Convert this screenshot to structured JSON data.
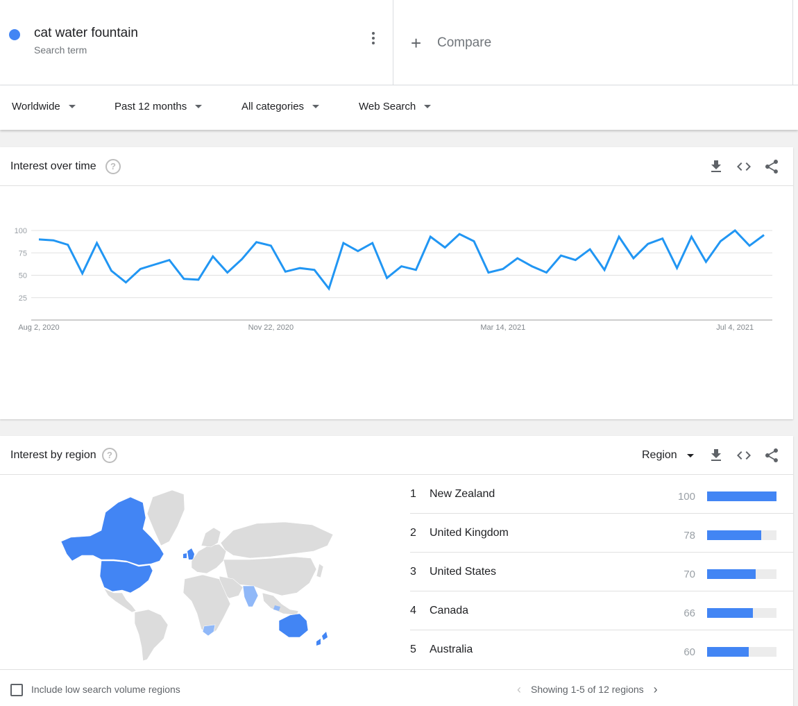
{
  "search_term": {
    "title": "cat water fountain",
    "subtitle": "Search term",
    "color": "#4285f4"
  },
  "compare": {
    "label": "Compare",
    "icon": "plus-icon"
  },
  "filters": [
    {
      "label": "Worldwide"
    },
    {
      "label": "Past 12 months"
    },
    {
      "label": "All categories"
    },
    {
      "label": "Web Search"
    }
  ],
  "interest_over_time": {
    "title": "Interest over time",
    "help_icon": "?",
    "tools": [
      "download-icon",
      "embed-icon",
      "share-icon"
    ]
  },
  "chart_data": {
    "type": "line",
    "title": "",
    "xlabel": "",
    "ylabel": "",
    "ylim": [
      0,
      100
    ],
    "yticks": [
      25,
      50,
      75,
      100
    ],
    "grid": true,
    "x_tick_labels": [
      "Aug 2, 2020",
      "Nov 22, 2020",
      "Mar 14, 2021",
      "Jul 4, 2021"
    ],
    "x_tick_indices": [
      0,
      16,
      32,
      48
    ],
    "series": [
      {
        "color": "#2196f3",
        "values": [
          90,
          89,
          84,
          52,
          86,
          55,
          42,
          57,
          62,
          67,
          46,
          45,
          71,
          53,
          68,
          87,
          83,
          54,
          58,
          56,
          35,
          86,
          77,
          86,
          47,
          60,
          56,
          93,
          81,
          96,
          88,
          53,
          57,
          69,
          60,
          53,
          72,
          67,
          79,
          56,
          93,
          69,
          85,
          91,
          58,
          93,
          65,
          88,
          100,
          83,
          95
        ]
      }
    ]
  },
  "interest_by_region": {
    "title": "Interest by region",
    "help_icon": "?",
    "resolution": "Region",
    "tools": [
      "download-icon",
      "embed-icon",
      "share-icon"
    ],
    "rows": [
      {
        "rank": "1",
        "name": "New Zealand",
        "value": 100
      },
      {
        "rank": "2",
        "name": "United Kingdom",
        "value": 78
      },
      {
        "rank": "3",
        "name": "United States",
        "value": 70
      },
      {
        "rank": "4",
        "name": "Canada",
        "value": 66
      },
      {
        "rank": "5",
        "name": "Australia",
        "value": 60
      }
    ],
    "low_volume_label": "Include low search volume regions",
    "pager_text": "Showing 1-5 of 12 regions",
    "map_colors": {
      "high": "#4285f4",
      "low": "#90b8f8",
      "none": "#dcdcdc"
    }
  }
}
